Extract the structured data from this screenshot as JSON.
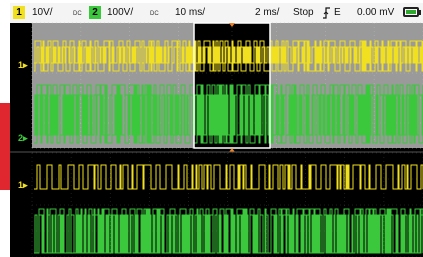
{
  "status_bar": {
    "ch1": {
      "number": "1",
      "scale": "10V/",
      "color": "#f0e020"
    },
    "ch2": {
      "number": "2",
      "scale": "100V/",
      "color": "#3cc83c"
    },
    "coupling_label": "DC",
    "timebase_main": "10 ms/",
    "timebase_zoom": "2 ms/",
    "run_state": "Stop",
    "trigger_icon": "trigger-edge-icon",
    "trigger_source": "E",
    "trigger_level": "0.00 mV",
    "battery_icon": "battery-icon",
    "battery_level": 0.8
  },
  "channel_markers": {
    "upper_ch1": "1",
    "upper_ch2": "2",
    "lower_ch1": "1"
  },
  "colors": {
    "ch1": "#f0e020",
    "ch2": "#3cc83c",
    "overview_background": "#9a9a9a",
    "zoom_window": "#000000",
    "accent": "#e0262e",
    "trigger_marker": "#f08020"
  }
}
